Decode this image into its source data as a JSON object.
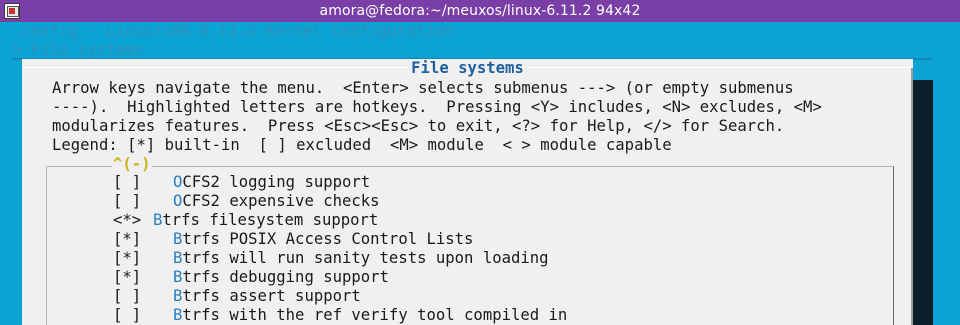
{
  "window": {
    "title": "amora@fedora:~/meuxos/linux-6.11.2 94x42"
  },
  "header": {
    "config_line": ".config - Linux/x86 6.11.2 Kernel Configuration",
    "breadcrumb": "> File systems"
  },
  "dialog": {
    "title": "File systems",
    "help_lines": [
      "Arrow keys navigate the menu.  <Enter> selects submenus ---> (or empty submenus",
      "----).  Highlighted letters are hotkeys.  Pressing <Y> includes, <N> excludes, <M>",
      "modularizes features.  Press <Esc><Esc> to exit, <?> for Help, </> for Search.",
      "Legend: [*] built-in  [ ] excluded  <M> module  < > module capable"
    ],
    "scroll_marker": "^(-)",
    "items": [
      {
        "state": "[ ]",
        "hotkey": "O",
        "rest": "CFS2 logging support"
      },
      {
        "state": "[ ]",
        "hotkey": "O",
        "rest": "CFS2 expensive checks"
      },
      {
        "state": "<*>",
        "hotkey": "B",
        "rest": "trfs filesystem support"
      },
      {
        "state": "[*]",
        "hotkey": "B",
        "rest": "trfs POSIX Access Control Lists"
      },
      {
        "state": "[*]",
        "hotkey": "B",
        "rest": "trfs will run sanity tests upon loading"
      },
      {
        "state": "[*]",
        "hotkey": "B",
        "rest": "trfs debugging support"
      },
      {
        "state": "[ ]",
        "hotkey": "B",
        "rest": "trfs assert support"
      },
      {
        "state": "[ ]",
        "hotkey": "B",
        "rest": "trfs with the ref verify tool compiled in"
      }
    ]
  },
  "colors": {
    "terminal_bg": "#0aa3d4",
    "titlebar_bg": "#7a3fa6",
    "dialog_bg": "#f0f0f0",
    "hotkey": "#2a7fc1",
    "title": "#1e5fa0",
    "scroll_marker": "#c9b41e"
  },
  "icons": {
    "app": "terminal-app-icon"
  }
}
